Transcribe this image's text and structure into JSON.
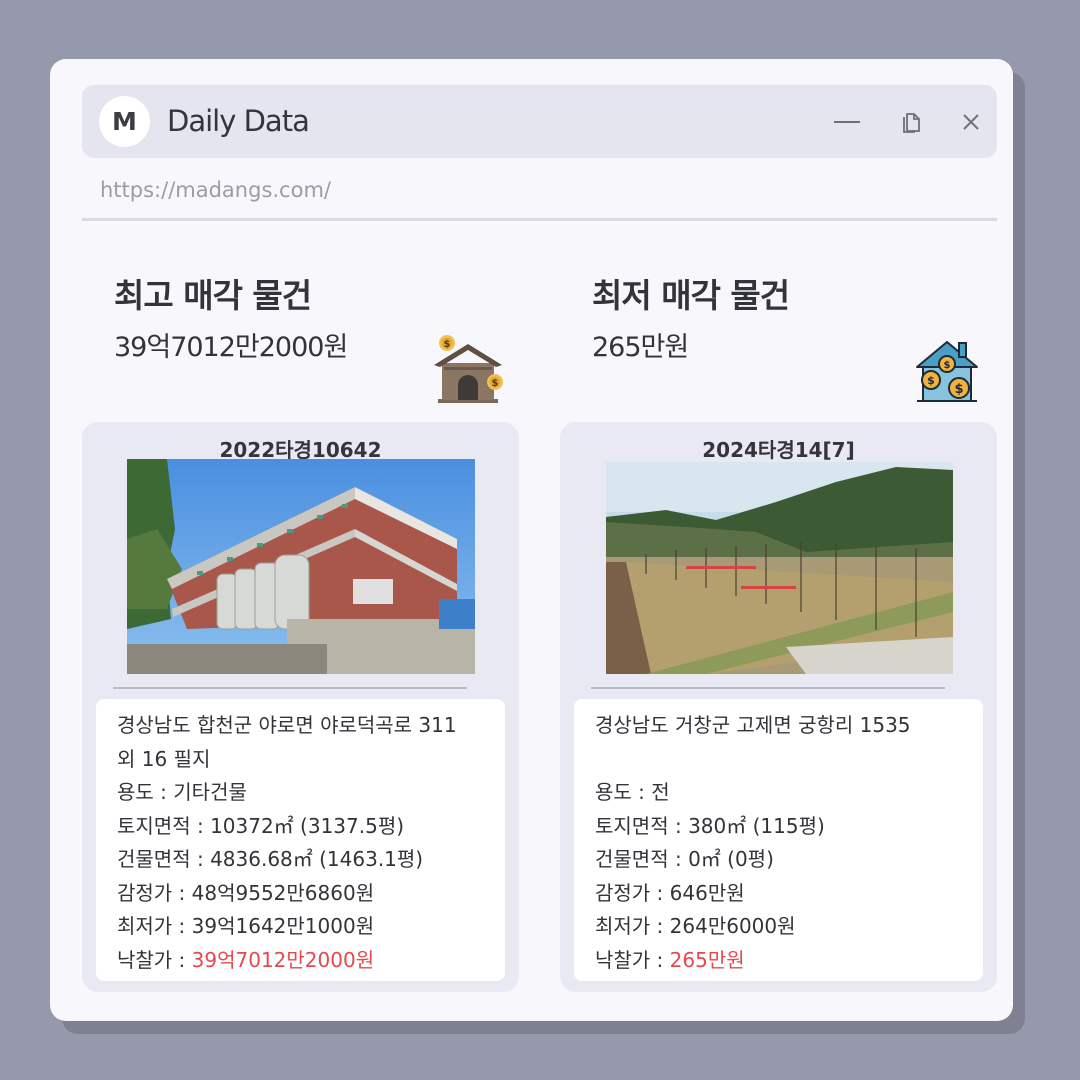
{
  "app": {
    "logo_letter": "M",
    "title": "Daily Data",
    "url": "https://madangs.com/"
  },
  "window_controls": {
    "minimize": "minimize-icon",
    "duplicate": "copy-icon",
    "close": "close-icon"
  },
  "highest": {
    "heading": "최고 매각 물건",
    "price": "39억7012만2000원",
    "icon": "house-money-icon",
    "case_no": "2022타경10642",
    "address_line1": "경상남도 합천군 야로면 야로덕곡로 311",
    "address_line2": "외 16 필지",
    "usage_label": "용도 : ",
    "usage": "기타건물",
    "land_label": "토지면적 : ",
    "land": "10372㎡ (3137.5평)",
    "building_label": "건물면적 : ",
    "building": "4836.68㎡ (1463.1평)",
    "appraisal_label": "감정가 : ",
    "appraisal": "48억9552만6860원",
    "minimum_label": "최저가 : ",
    "minimum": "39억1642만1000원",
    "winning_label": "낙찰가 : ",
    "winning": "39억7012만2000원"
  },
  "lowest": {
    "heading": "최저 매각 물건",
    "price": "265만원",
    "icon": "house-coins-icon",
    "case_no": "2024타경14[7]",
    "address_line1": "경상남도 거창군 고제면 궁항리 1535",
    "address_line2": "",
    "usage_label": "용도 :  ",
    "usage": "전",
    "land_label": "토지면적 : ",
    "land": "380㎡ (115평)",
    "building_label": "건물면적 : ",
    "building": "0㎡ (0평)",
    "appraisal_label": "감정가 : ",
    "appraisal": "646만원",
    "minimum_label": "최저가 : ",
    "minimum": "264만6000원",
    "winning_label": "낙찰가 : ",
    "winning": "265만원"
  },
  "colors": {
    "accent_red": "#e4494e",
    "background": "#9699ab",
    "window": "#f7f7fc"
  }
}
